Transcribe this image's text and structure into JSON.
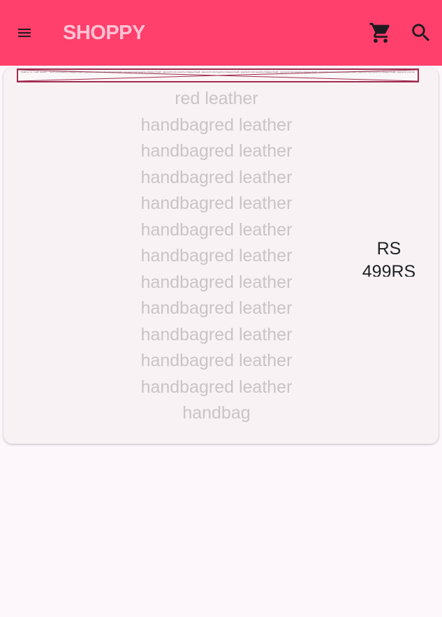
{
  "app_bar": {
    "title": "SHOPPY",
    "menu_icon": "menu-icon",
    "cart_icon": "shopping-cart-icon",
    "search_icon": "search-icon",
    "background_color": "#ff3f6c",
    "title_color": "#ffc2d3"
  },
  "product_card": {
    "image_error_text": "Unable to load asset: \"android/assets/images/bag1.jpg/android/assets/images/bag2.jpg/android/assets/images/bag3.jpg/android/assets/images/bag4.jpg/android/assets/images/bag5.jpg/android/assets/images/bag6.jpg/android/assets/images/bag7.jpg/android/assets/images/bag8.jpg/android/assets/images/bag9.jpg/android/assets/images/bag10.jpg/android/assets/images/bag11.jpg\"",
    "description_lines": [
      "red leather",
      "handbagred leather",
      "handbagred leather",
      "handbagred leather",
      "handbagred leather",
      "handbagred leather",
      "handbagred leather",
      "handbagred leather",
      "handbagred leather",
      "handbagred leather",
      "handbagred leather",
      "handbagred leather",
      "handbag"
    ],
    "price": "RS 499RS"
  }
}
